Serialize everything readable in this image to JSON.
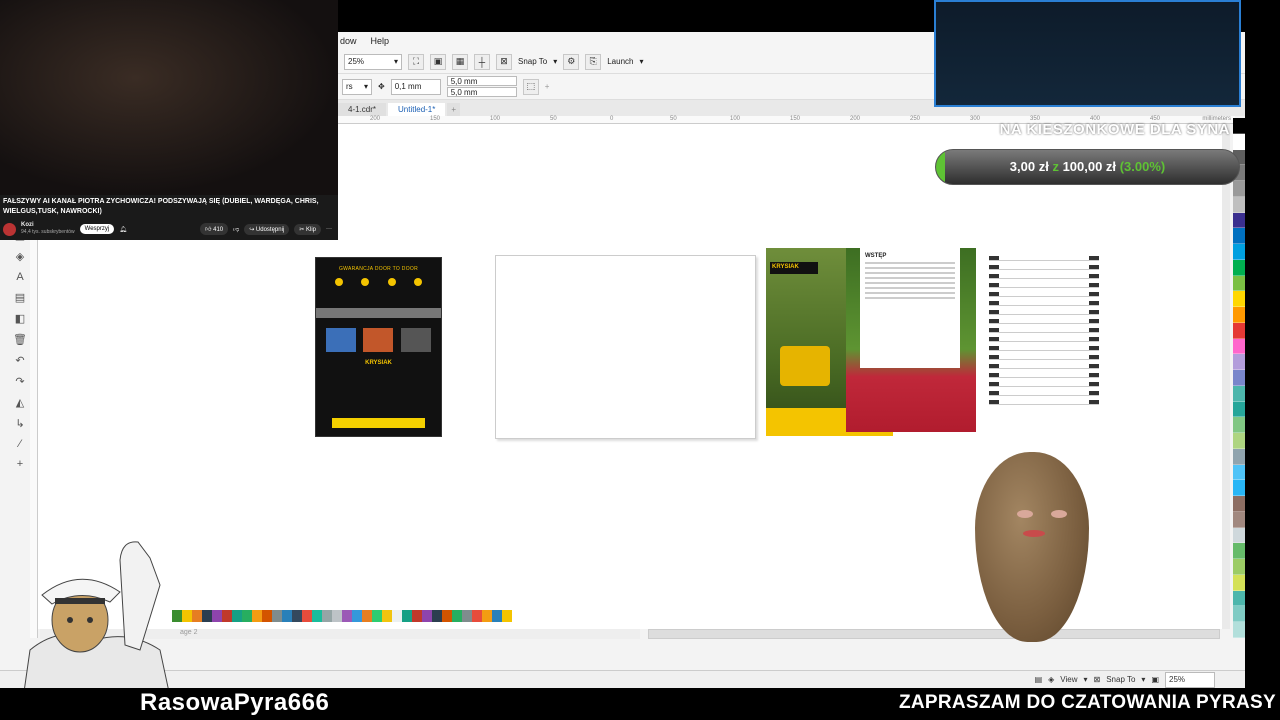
{
  "menu": {
    "items": [
      "dow",
      "Help"
    ]
  },
  "toolbar": {
    "zoom_value": "25%",
    "snap_to": "Snap To",
    "launch": "Launch",
    "units_partial": "rs",
    "nudge": "0,1 mm",
    "dup_x": "5,0 mm",
    "dup_y": "5,0 mm"
  },
  "tabs": [
    {
      "label": "4-1.cdr*"
    },
    {
      "label": "Untitled-1*"
    }
  ],
  "ruler": {
    "unit": "millimeters",
    "ticks": [
      "200",
      "150",
      "100",
      "50",
      "0",
      "50",
      "100",
      "150",
      "200",
      "250",
      "300",
      "350",
      "400",
      "450"
    ]
  },
  "pagebar": {
    "label": "age 2"
  },
  "statusbar": {
    "view": "View",
    "snap_to": "Snap To",
    "zoom": "25%"
  },
  "youtube": {
    "title": "FAŁSZYWY AI KANAŁ PIOTRA ZYCHOWICZA! PODSZYWAJĄ SIĘ (DUBIEL, WARDĘGA, CHRIS, WIELGUS,TUSK, NAWROCKI)",
    "channel": "Kozi",
    "subscribers": "94,4 tys. subskrybentów",
    "support": "Wesprzyj",
    "likes": "410",
    "share": "Udostępnij",
    "clip": "Klip",
    "more": "···"
  },
  "donation_goal": {
    "title": "NA KIESZONKOWE DLA SYNA",
    "current": "3,00 zł",
    "separator": "z",
    "target": "100,00 zł",
    "percent_label": "(3.00%)",
    "progress": 0.03,
    "fill_color": "#5ec234"
  },
  "pages": {
    "black_title": "GWARANCJA DOOR TO DOOR",
    "black_logo": "KRYSIAK",
    "cover_brand": "KRYSIAK",
    "tulip_heading": "WSTĘP"
  },
  "overlay": {
    "nickname": "RasowaPyra666",
    "invite": "ZAPRASZAM DO CZATOWANIA PYRASY"
  },
  "palette_colors": [
    "#000000",
    "#ffffff",
    "#5f5f5f",
    "#7a7a7a",
    "#9a9a9a",
    "#bfbfbf",
    "#3b2f8f",
    "#0070c0",
    "#00a0e0",
    "#00b050",
    "#7bc043",
    "#ffd700",
    "#ff9900",
    "#e53935",
    "#ff66cc",
    "#b39ddb",
    "#7986cb",
    "#4db6ac",
    "#26a69a",
    "#81c784",
    "#aed581",
    "#90a4ae",
    "#4fc3f7",
    "#29b6f6",
    "#8d6e63",
    "#a1887f",
    "#cfd8dc",
    "#66bb6a",
    "#9ccc65",
    "#d4e157",
    "#4db6ac",
    "#80cbc4",
    "#b2dfdb"
  ],
  "bottom_palette_colors": [
    "#3a8d2f",
    "#f4c400",
    "#e67e22",
    "#2c3e50",
    "#8e44ad",
    "#c0392b",
    "#16a085",
    "#27ae60",
    "#f39c12",
    "#d35400",
    "#7f8c8d",
    "#2980b9",
    "#34495e",
    "#e74c3c",
    "#1abc9c",
    "#95a5a6",
    "#bdc3c7",
    "#9b59b6",
    "#3498db",
    "#e67e22",
    "#2ecc71",
    "#f1c40f",
    "#ecf0f1",
    "#16a085",
    "#c0392b",
    "#8e44ad",
    "#2c3e50",
    "#d35400",
    "#27ae60",
    "#7f8c8d",
    "#e74c3c",
    "#f39c12",
    "#2980b9",
    "#f4c400"
  ]
}
